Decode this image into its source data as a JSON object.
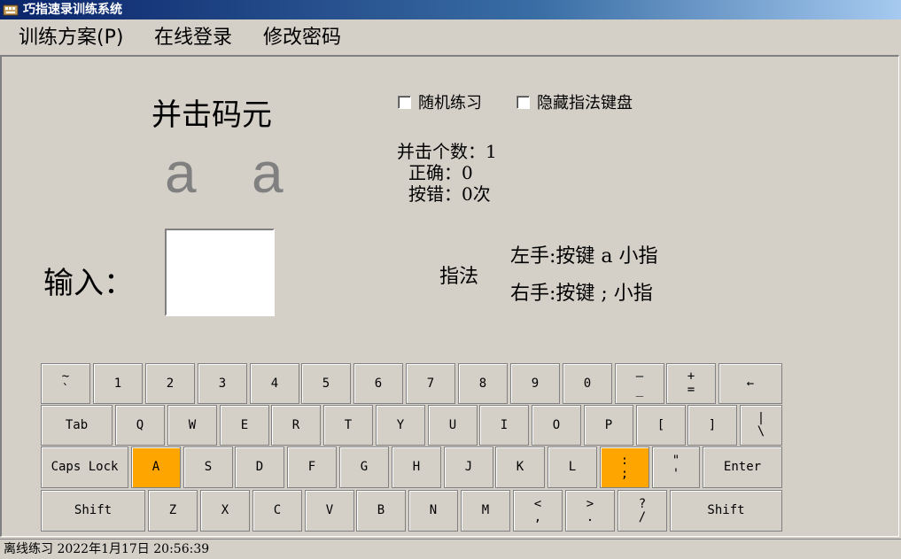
{
  "window": {
    "title": "巧指速录训练系统"
  },
  "menu": [
    {
      "label": "训练方案(P)"
    },
    {
      "label": "在线登录"
    },
    {
      "label": "修改密码"
    }
  ],
  "practice": {
    "section_title": "并击码元",
    "target_left": "a",
    "target_right": "a",
    "random_practice_label": "随机练习",
    "hide_keyboard_label": "隐藏指法键盘",
    "random_practice_checked": false,
    "hide_keyboard_checked": false
  },
  "stats": {
    "count_line": "并击个数：1",
    "correct_line": "正确：0",
    "errors_line": "按错：0次"
  },
  "input": {
    "label": "输入：",
    "value": ""
  },
  "fingering": {
    "label": "指法",
    "left_hand": "左手:按键 a 小指",
    "right_hand": "右手:按键 ; 小指"
  },
  "keyboard": {
    "highlight_color": "#ffa500",
    "rows": [
      [
        {
          "id": "tilde",
          "label": "~\n`"
        },
        {
          "id": "1",
          "label": "1"
        },
        {
          "id": "2",
          "label": "2"
        },
        {
          "id": "3",
          "label": "3"
        },
        {
          "id": "4",
          "label": "4"
        },
        {
          "id": "5",
          "label": "5"
        },
        {
          "id": "6",
          "label": "6"
        },
        {
          "id": "7",
          "label": "7"
        },
        {
          "id": "8",
          "label": "8"
        },
        {
          "id": "9",
          "label": "9"
        },
        {
          "id": "0",
          "label": "0"
        },
        {
          "id": "minus",
          "label": "–\n_"
        },
        {
          "id": "plus",
          "label": "+\n="
        },
        {
          "id": "backspace",
          "label": "←"
        }
      ],
      [
        {
          "id": "tab",
          "label": "Tab"
        },
        {
          "id": "q",
          "label": "Q"
        },
        {
          "id": "w",
          "label": "W"
        },
        {
          "id": "e",
          "label": "E"
        },
        {
          "id": "r",
          "label": "R"
        },
        {
          "id": "t",
          "label": "T"
        },
        {
          "id": "y",
          "label": "Y"
        },
        {
          "id": "u",
          "label": "U"
        },
        {
          "id": "i",
          "label": "I"
        },
        {
          "id": "o",
          "label": "O"
        },
        {
          "id": "p",
          "label": "P"
        },
        {
          "id": "lbracket",
          "label": "["
        },
        {
          "id": "rbracket",
          "label": "]"
        },
        {
          "id": "backslash",
          "label": "|\n\\"
        }
      ],
      [
        {
          "id": "capslock",
          "label": "Caps Lock"
        },
        {
          "id": "a",
          "label": "A",
          "highlighted": true
        },
        {
          "id": "s",
          "label": "S"
        },
        {
          "id": "d",
          "label": "D"
        },
        {
          "id": "f",
          "label": "F"
        },
        {
          "id": "g",
          "label": "G"
        },
        {
          "id": "h",
          "label": "H"
        },
        {
          "id": "j",
          "label": "J"
        },
        {
          "id": "k",
          "label": "K"
        },
        {
          "id": "l",
          "label": "L"
        },
        {
          "id": "semicolon",
          "label": ":\n;",
          "highlighted": true
        },
        {
          "id": "quote",
          "label": "\"\n'"
        },
        {
          "id": "enter",
          "label": "Enter"
        }
      ],
      [
        {
          "id": "lshift",
          "label": "Shift"
        },
        {
          "id": "z",
          "label": "Z"
        },
        {
          "id": "x",
          "label": "X"
        },
        {
          "id": "c",
          "label": "C"
        },
        {
          "id": "v",
          "label": "V"
        },
        {
          "id": "b",
          "label": "B"
        },
        {
          "id": "n",
          "label": "N"
        },
        {
          "id": "m",
          "label": "M"
        },
        {
          "id": "comma",
          "label": "<\n,"
        },
        {
          "id": "period",
          "label": ">\n."
        },
        {
          "id": "slash",
          "label": "?\n/"
        },
        {
          "id": "rshift",
          "label": "Shift"
        }
      ]
    ]
  },
  "status": {
    "text": "离线练习 2022年1月17日 20:56:39"
  }
}
